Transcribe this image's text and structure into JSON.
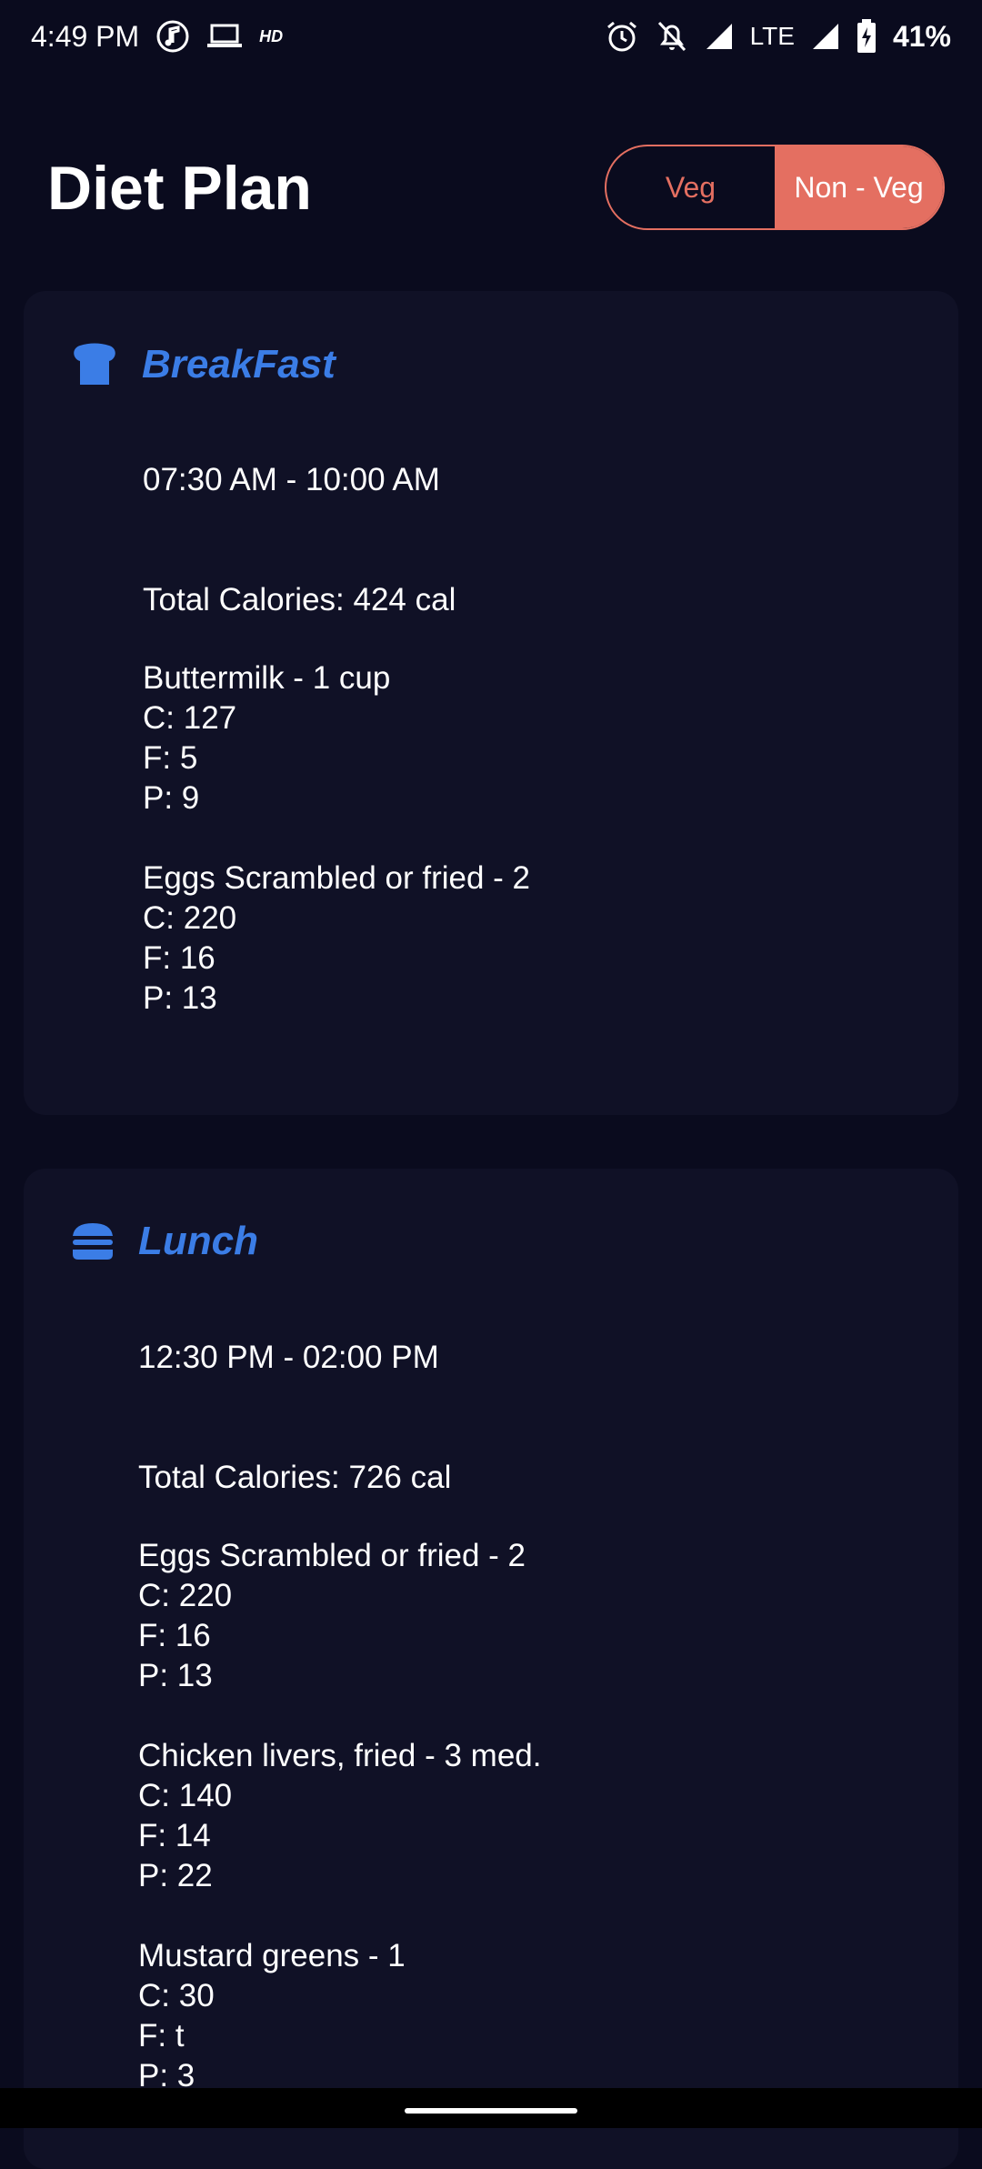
{
  "status_bar": {
    "time": "4:49 PM",
    "hd": "HD",
    "network": "LTE",
    "battery": "41%"
  },
  "header": {
    "title": "Diet Plan",
    "toggle": {
      "veg": "Veg",
      "non_veg": "Non - Veg",
      "selected": "non_veg"
    }
  },
  "colors": {
    "background": "#0a0b1e",
    "card": "#101126",
    "accent": "#e46f61",
    "meal_title": "#3b7de6"
  },
  "meals": [
    {
      "name": "BreakFast",
      "icon": "bread-icon",
      "time": "07:30 AM  -  10:00 AM",
      "total": "Total Calories:  424 cal",
      "items": [
        {
          "name": "Buttermilk - 1 cup",
          "c": "C:  127",
          "f": "F:  5",
          "p": "P:  9"
        },
        {
          "name": "Eggs Scrambled or fried - 2",
          "c": "C:  220",
          "f": "F:  16",
          "p": "P:  13"
        }
      ]
    },
    {
      "name": "Lunch",
      "icon": "burger-icon",
      "time": "12:30 PM  -  02:00 PM",
      "total": "Total Calories:  726 cal",
      "items": [
        {
          "name": "Eggs Scrambled or fried - 2",
          "c": "C:  220",
          "f": "F:  16",
          "p": "P:  13"
        },
        {
          "name": "Chicken livers, fried - 3 med.",
          "c": "C:  140",
          "f": "F:  14",
          "p": "P:  22"
        },
        {
          "name": "Mustard greens - 1",
          "c": "C:  30",
          "f": "F:  t",
          "p": "P:  3"
        }
      ]
    }
  ]
}
